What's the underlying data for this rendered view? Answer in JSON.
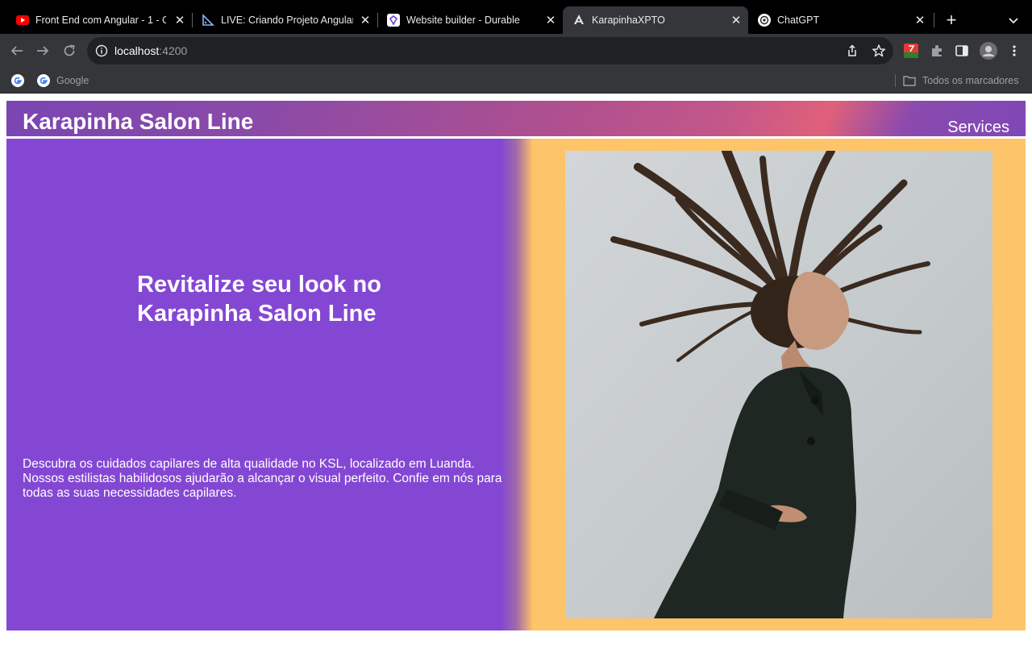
{
  "browser": {
    "tabs": [
      {
        "title": "Front End com Angular - 1 - C",
        "favicon": "youtube-icon"
      },
      {
        "title": "LIVE: Criando Projeto Angular",
        "favicon": "ruler-triangle-icon"
      },
      {
        "title": "Website builder - Durable",
        "favicon": "durable-icon"
      },
      {
        "title": "KarapinhaXPTO",
        "favicon": "angular-icon",
        "active": true
      },
      {
        "title": "ChatGPT",
        "favicon": "chatgpt-icon"
      }
    ],
    "url_host": "localhost",
    "url_port": ":4200",
    "bookmarks": [
      {
        "label": "",
        "icon": "google-icon"
      },
      {
        "label": "Google",
        "icon": "google-icon"
      }
    ],
    "all_bookmarks_label": "Todos os marcadores"
  },
  "site": {
    "brand": "Karapinha Salon Line",
    "nav": {
      "services": "Services"
    },
    "hero": {
      "headline": "Revitalize seu look no Karapinha Salon Line",
      "description": "Descubra os cuidados capilares de alta qualidade no KSL, localizado em Luanda. Nossos estilistas habilidosos ajudarão a alcançar o visual perfeito. Confie em nós para todas as suas necessidades capilares."
    }
  },
  "colors": {
    "hero_left": "#8447d3",
    "hero_right": "#fec46a",
    "header_gradient": [
      "#7a45b3",
      "#c2578a",
      "#e0607a",
      "#7f48b6"
    ]
  }
}
